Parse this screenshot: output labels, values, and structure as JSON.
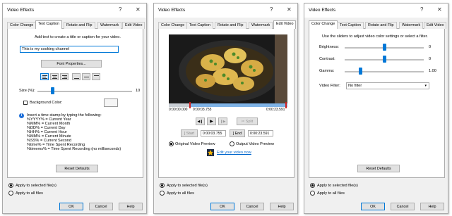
{
  "dialog_title": "Video Effects",
  "title_help": "?",
  "title_close": "✕",
  "tabs": [
    "Color Change",
    "Text Caption",
    "Rotate and Flip",
    "Watermark",
    "Edit Video"
  ],
  "caption_panel": {
    "intro": "Add text to create a title or caption for your video.",
    "text_value": "This is my cooking channel",
    "font_button": "Font Properties...",
    "size_label": "Size (%):",
    "size_value": "10",
    "size_fraction": 0.1,
    "bg_color_label": "Background Color:",
    "timestamp_intro": "Insert a time stamp by typing the following:",
    "timestamp_lines": [
      "%YYYY% = Current Year",
      "%MM% = Current Month",
      "%DD% = Current Day",
      "%HH% = Current Hour",
      "%MM% = Current Minute",
      "%SS% = Current Second",
      "%time% = Time Spent Recording",
      "%timems% = Time Spent Recording (no milliseconds)"
    ],
    "reset_button": "Reset Defaults"
  },
  "edit_panel": {
    "time_start": "0:00:00.000",
    "time_mid": "0:00:03.755",
    "time_end": "0:00:23.591",
    "split_button": "Split",
    "start_button": "Start",
    "start_time": "0:00:03.755",
    "end_button": "End",
    "end_time": "0:00:23.591",
    "original_preview": "Original Video Preview",
    "output_preview": "Output Video Preview",
    "edit_link": "Edit your video now"
  },
  "color_panel": {
    "intro": "Use the sliders to adjust video color settings or select a filter.",
    "brightness_label": "Brightness:",
    "brightness_value": "0",
    "contrast_label": "Contrast:",
    "contrast_value": "0",
    "gamma_label": "Gamma:",
    "gamma_value": "1.00",
    "filter_label": "Video Filter:",
    "filter_value": "No filter",
    "reset_button": "Reset Defaults"
  },
  "apply_selected": "Apply to selected file(s)",
  "apply_all": "Apply to all files",
  "ok": "OK",
  "cancel": "Cancel",
  "help": "Help",
  "colors": {
    "accent": "#0078d7",
    "link": "#0066cc"
  }
}
